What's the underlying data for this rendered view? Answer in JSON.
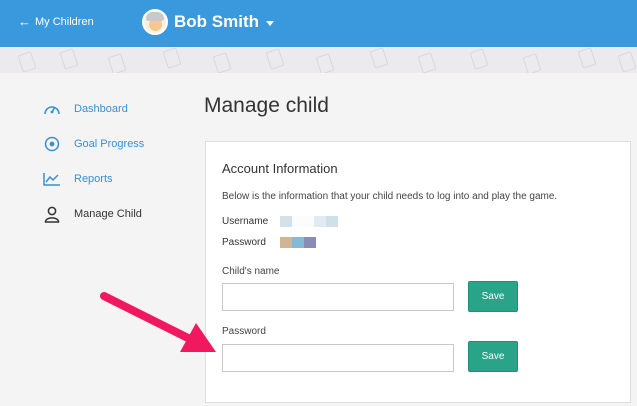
{
  "header": {
    "back_label": "My Children",
    "user_name": "Bob Smith"
  },
  "sidebar": {
    "items": [
      {
        "label": "Dashboard",
        "icon": "gauge-icon"
      },
      {
        "label": "Goal Progress",
        "icon": "target-icon"
      },
      {
        "label": "Reports",
        "icon": "chart-icon"
      },
      {
        "label": "Manage Child",
        "icon": "user-icon"
      }
    ]
  },
  "main": {
    "title": "Manage child",
    "card": {
      "title": "Account Information",
      "description": "Below is the information that your child needs to log into and play the game.",
      "username_label": "Username",
      "password_label": "Password",
      "childs_name_label": "Child's name",
      "childs_name_value": "",
      "password_field_label": "Password",
      "password_field_value": "",
      "save_label_1": "Save",
      "save_label_2": "Save"
    }
  },
  "colors": {
    "header": "#3a98dc",
    "accent": "#29a489",
    "link": "#3a8fce",
    "annotation_arrow": "#f0185f"
  }
}
